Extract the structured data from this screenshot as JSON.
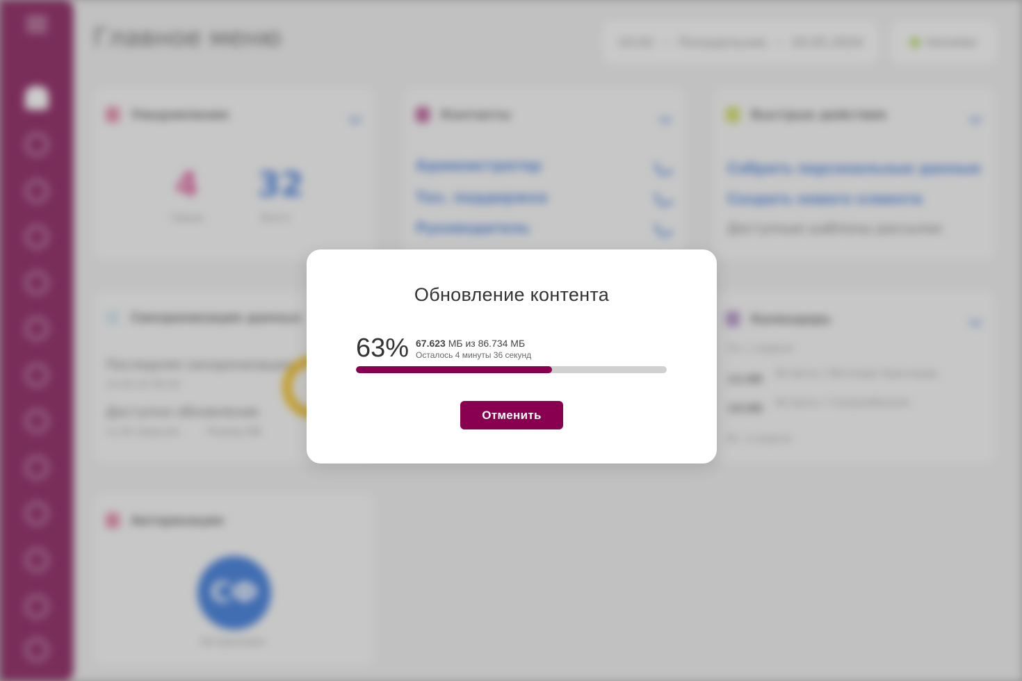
{
  "background": {
    "page_title": "Главное меню",
    "top_info": {
      "time": "10:02",
      "day": "Понедельник",
      "date": "20.05.2024"
    },
    "user": {
      "status_color": "#a6cf3f",
      "name": "nouveau"
    },
    "sidebar": {
      "color": "#7a0048",
      "icons": [
        "menu-icon",
        "home-icon",
        "clock-icon",
        "calendar-icon",
        "target-icon",
        "calendar-icon",
        "heart-icon",
        "clock-icon",
        "users-icon",
        "phone-icon",
        "list-icon",
        "settings-icon",
        "chart-icon",
        "gear-icon"
      ]
    },
    "cards": {
      "notifications": {
        "title": "Уведомления",
        "count_new": "4",
        "label_new": "Новые",
        "count_all": "32",
        "label_all": "Всего"
      },
      "contacts": {
        "title": "Контакты",
        "items": [
          "Администратор",
          "Тех. поддержка",
          "Руководитель"
        ]
      },
      "quick_actions": {
        "title": "Быстрые действия",
        "items": [
          "Собрать персональные данные",
          "Создать нового клиента",
          "Доступные шаблоны рассылок"
        ]
      },
      "sync": {
        "title": "Синхронизация данных",
        "last_sync_label": "Последняя синхронизация",
        "last_sync_value": "14.05.24 09:30",
        "updates_label": "Доступно обновление",
        "updates_value": "12.05 (версия)",
        "size_value": "Размер МБ"
      },
      "calendar": {
        "title": "Календарь",
        "day1": "Пн, 1 апреля",
        "event1_time": "11:00",
        "event1_text": "Встреча с Мегапарк Краснодар",
        "event2_time": "15:00",
        "event2_text": "Встреча с Газпромбанком",
        "day2": "Вт, 2 апреля"
      },
      "auth": {
        "title": "Авторизация",
        "avatar_initials": "СФ",
        "caption": "Авторизован"
      }
    }
  },
  "modal": {
    "title": "Обновление контента",
    "percent_label": "63%",
    "progress": 0.63,
    "downloaded": "67.623",
    "size_suffix": "МБ из 86.734 МБ",
    "eta": "Осталось 4 минуты 36 секунд",
    "cancel_label": "Отменить",
    "accent_color": "#8a0050"
  }
}
